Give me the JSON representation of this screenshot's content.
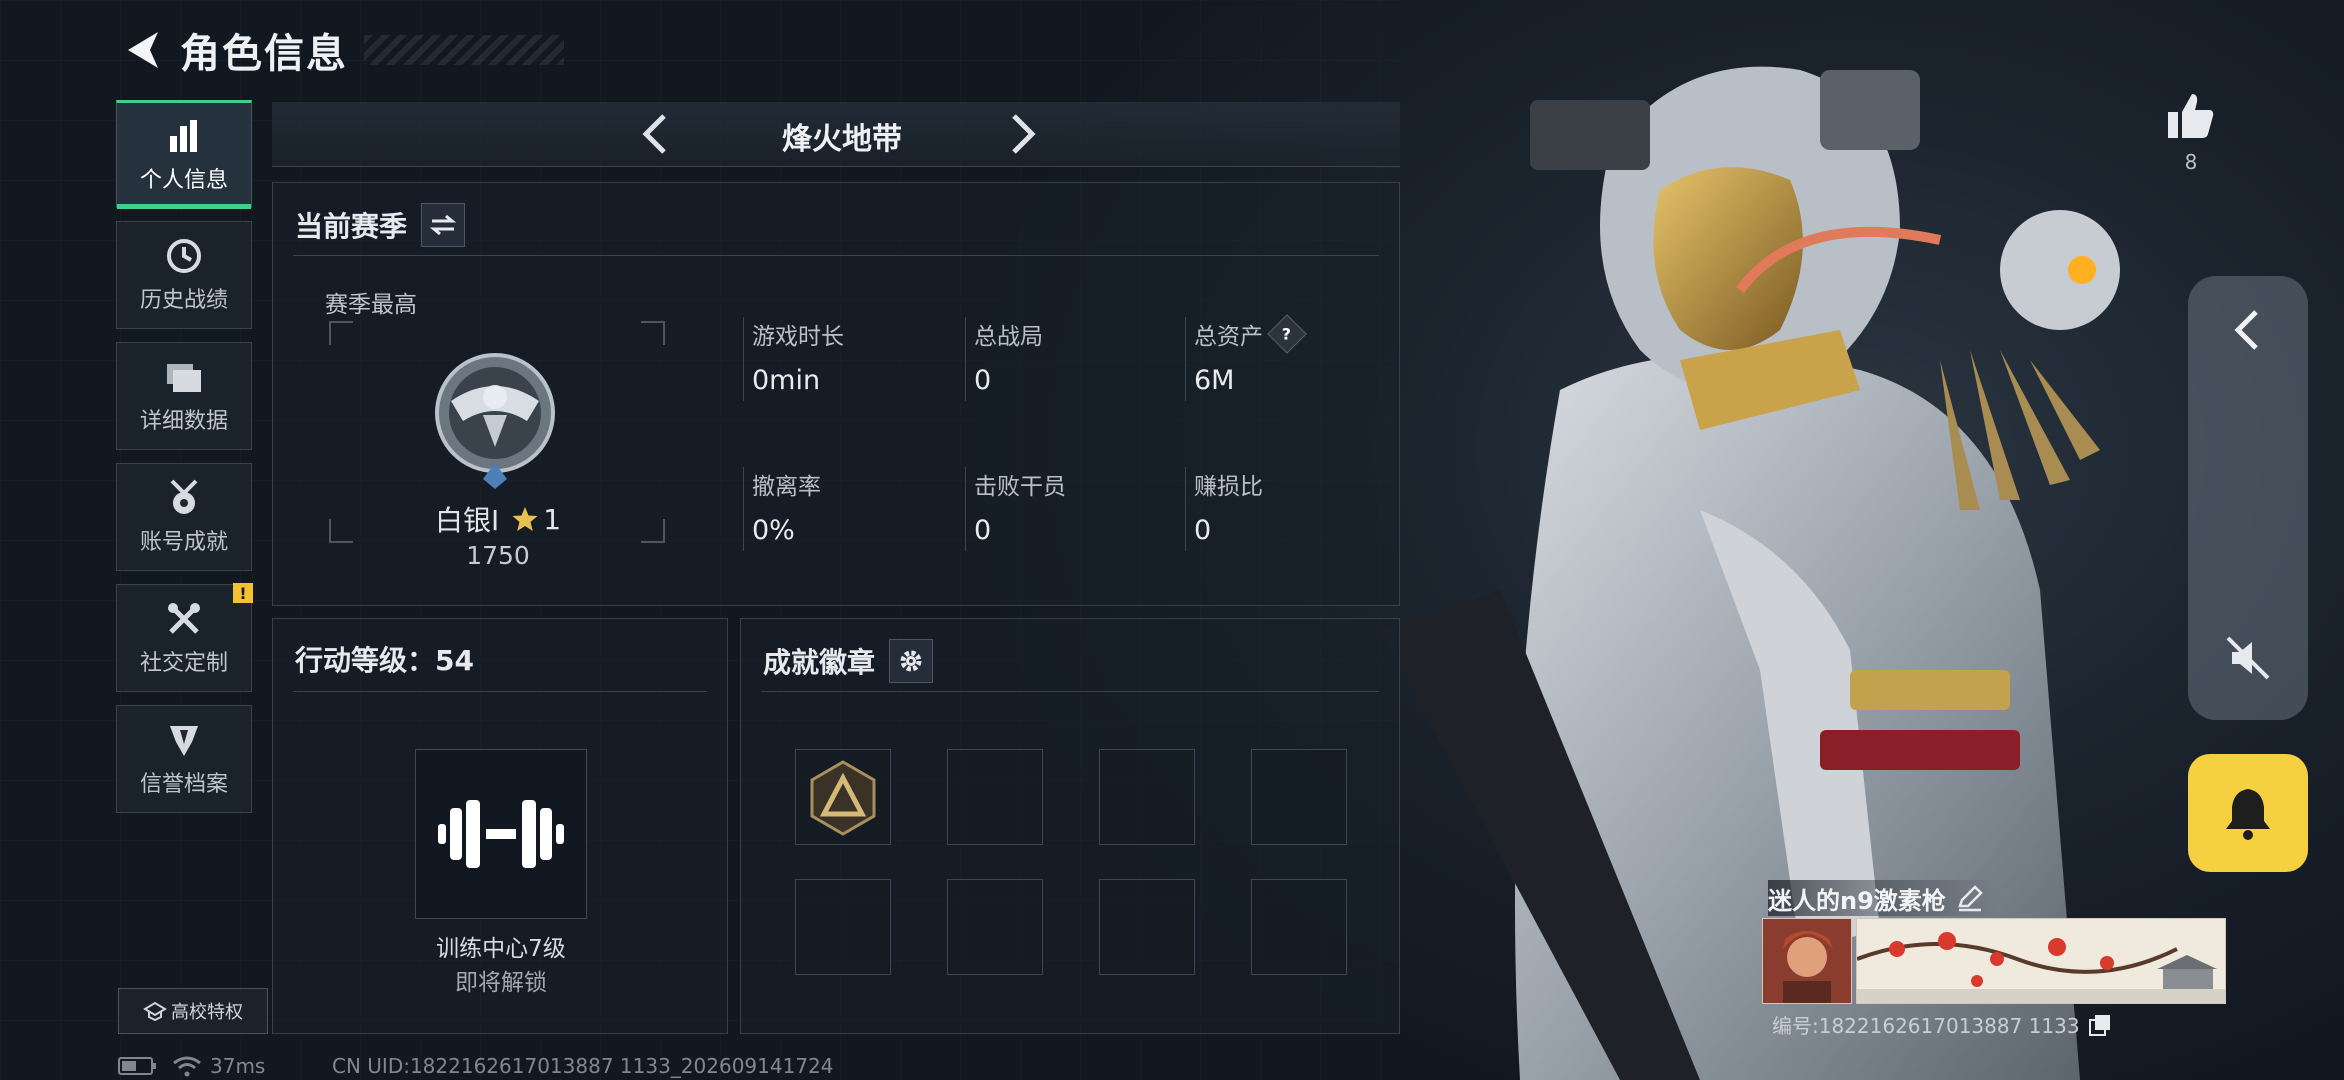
{
  "header": {
    "title": "角色信息",
    "back_icon": "back-arrow-icon"
  },
  "nav": {
    "items": [
      {
        "label": "个人信息",
        "icon": "bar-chart-icon",
        "active": true
      },
      {
        "label": "历史战绩",
        "icon": "clock-history-icon",
        "active": false
      },
      {
        "label": "详细数据",
        "icon": "folder-icon",
        "active": false
      },
      {
        "label": "账号成就",
        "icon": "medal-icon",
        "active": false
      },
      {
        "label": "社交定制",
        "icon": "tools-icon",
        "active": false,
        "badge": "!"
      },
      {
        "label": "信誉档案",
        "icon": "reputation-icon",
        "active": false
      }
    ],
    "campus_label": "高校特权"
  },
  "status": {
    "ping": "37ms",
    "uid": "CN UID:1822162617013887 1133_202609141724"
  },
  "mode": {
    "title": "烽火地带"
  },
  "season": {
    "title": "当前赛季",
    "best_label": "赛季最高",
    "rank_name": "白银Ⅰ",
    "rank_stars": "1",
    "rank_score": "1750",
    "stats": [
      {
        "label": "游戏时长",
        "value": "0min"
      },
      {
        "label": "总战局",
        "value": "0"
      },
      {
        "label": "总资产",
        "value": "6M",
        "help": "?"
      },
      {
        "label": "撤离率",
        "value": "0%"
      },
      {
        "label": "击败干员",
        "value": "0"
      },
      {
        "label": "赚损比",
        "value": "0"
      }
    ]
  },
  "level": {
    "title": "行动等级：54",
    "training_title": "训练中心7级",
    "training_sub": "即将解锁"
  },
  "badges": {
    "title": "成就徽章",
    "slots": 8,
    "filled": 1
  },
  "like": {
    "count": "8"
  },
  "player": {
    "name": "迷人的n9激素枪",
    "id": "编号:1822162617013887 1133"
  },
  "colors": {
    "accent": "#3fd08a",
    "bell": "#f5d142",
    "warn": "#f2c230"
  }
}
